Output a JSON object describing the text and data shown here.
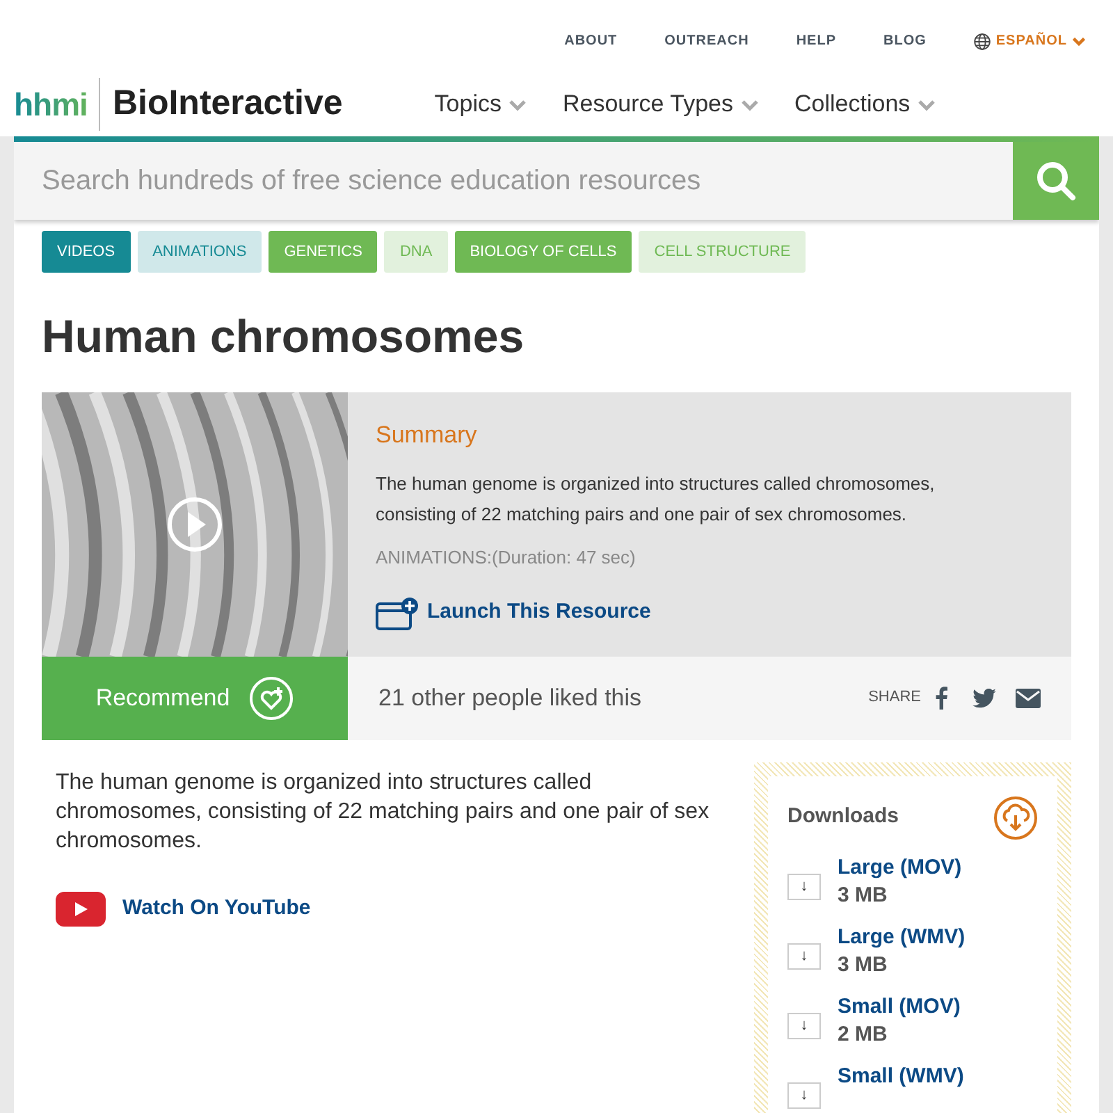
{
  "utility_nav": [
    "ABOUT",
    "OUTREACH",
    "HELP",
    "BLOG"
  ],
  "language": "ESPAÑOL",
  "logo": {
    "brand": "hhmi",
    "product": "BioInteractive"
  },
  "main_nav": [
    "Topics",
    "Resource Types",
    "Collections"
  ],
  "search": {
    "placeholder": "Search hundreds of free science education resources"
  },
  "tags": [
    {
      "label": "VIDEOS",
      "kind": "solid",
      "color": "#168a94"
    },
    {
      "label": "ANIMATIONS",
      "kind": "pale",
      "color": "#168a94"
    },
    {
      "label": "GENETICS",
      "kind": "solid",
      "color": "#6fb954"
    },
    {
      "label": "DNA",
      "kind": "pale",
      "color": "#6fb954"
    },
    {
      "label": "BIOLOGY OF CELLS",
      "kind": "solid",
      "color": "#6fb954"
    },
    {
      "label": "CELL STRUCTURE",
      "kind": "pale",
      "color": "#6fb954"
    }
  ],
  "title": "Human chromosomes",
  "media": {
    "kind": "picture"
  },
  "summary": {
    "heading": "Summary",
    "text": "The human genome is organized into structures called chromosomes, consisting of 22 matching pairs and one pair of sex chromosomes.",
    "meta": "ANIMATIONS:(Duration: 47 sec)",
    "launch": "Launch This Resource"
  },
  "recommend": {
    "button": "Recommend",
    "likes": "21 other people liked this",
    "share": "SHARE"
  },
  "description": "The human genome is organized into structures called chromosomes, consisting of 22 matching pairs and one pair of sex chromosomes.",
  "youtube": "Watch On YouTube",
  "downloads": {
    "heading": "Downloads",
    "items": [
      {
        "icon": "↓",
        "name": "Large (MOV)",
        "size": "3 MB"
      },
      {
        "icon": "↓",
        "name": "Large (WMV)",
        "size": "3 MB"
      },
      {
        "icon": "↓",
        "name": "Small (MOV)",
        "size": "2 MB"
      },
      {
        "icon": "↓",
        "name": "Small (WMV)"
      }
    ]
  }
}
